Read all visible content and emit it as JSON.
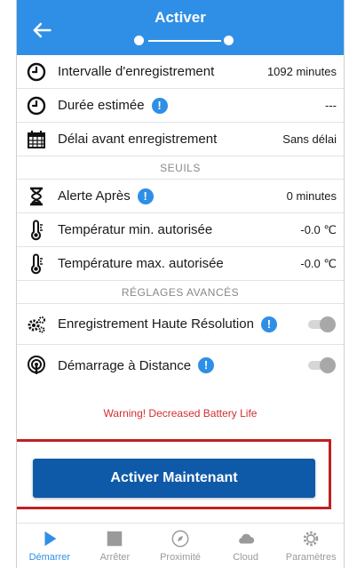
{
  "header": {
    "title": "Activer"
  },
  "rows": {
    "interval": {
      "label": "Intervalle d'enregistrement",
      "value": "1092 minutes"
    },
    "duration": {
      "label": "Durée estimée",
      "value": "---"
    },
    "delay": {
      "label": "Délai avant enregistrement",
      "value": "Sans délai"
    },
    "alert": {
      "label": "Alerte Après",
      "value": "0 minutes"
    },
    "temp_min": {
      "label": "Températur min. autorisée",
      "value": "-0.0 ℃"
    },
    "temp_max": {
      "label": "Température max. autorisée",
      "value": "-0.0 ℃"
    },
    "hires": {
      "label": "Enregistrement Haute Résolution"
    },
    "remote": {
      "label": "Démarrage à Distance"
    }
  },
  "sections": {
    "thresholds": "SEUILS",
    "advanced": "RÉGLAGES AVANCÉS"
  },
  "info_glyph": "!",
  "warning": "Warning! Decreased Battery Life",
  "cta": "Activer Maintenant",
  "tabs": [
    {
      "label": "Démarrer",
      "icon": "play-icon",
      "active": true
    },
    {
      "label": "Arrêter",
      "icon": "stop-icon"
    },
    {
      "label": "Proximité",
      "icon": "compass-icon"
    },
    {
      "label": "Cloud",
      "icon": "cloud-icon"
    },
    {
      "label": "Paramètres",
      "icon": "gear-icon"
    }
  ],
  "colors": {
    "primary": "#2f8fe6",
    "cta": "#0f5aa8",
    "warning": "#d32f2f",
    "highlight": "#c02020"
  }
}
